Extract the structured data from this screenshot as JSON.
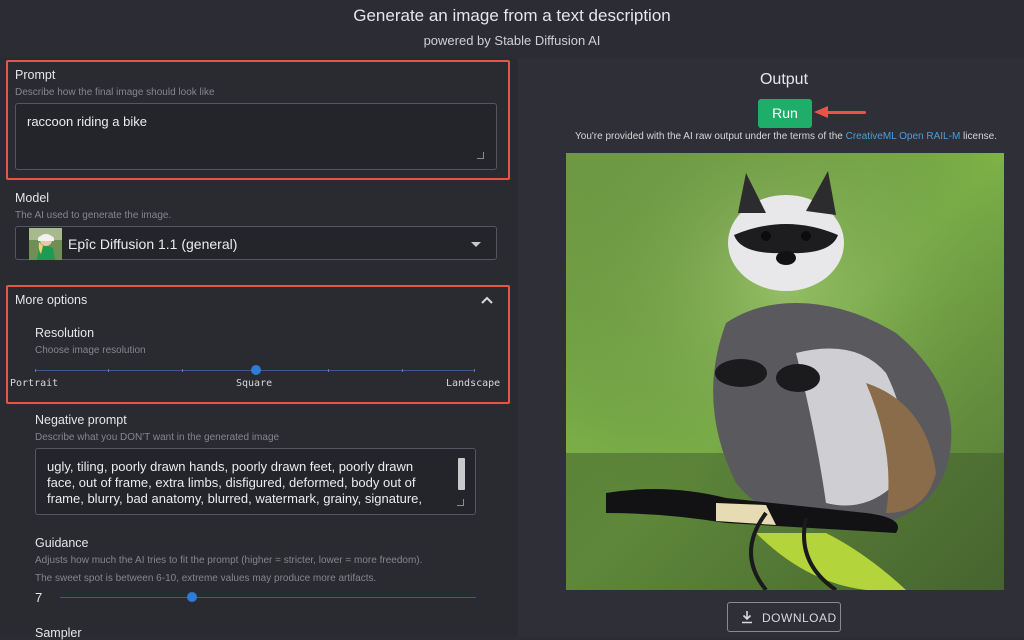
{
  "header": {
    "title": "Generate an image from a text description",
    "subtitle": "powered by Stable Diffusion AI"
  },
  "prompt": {
    "label": "Prompt",
    "help": "Describe how the final image should look like",
    "value": "raccoon riding a bike"
  },
  "model": {
    "label": "Model",
    "help": "The AI used to generate the image.",
    "selected": "Epîc Diffusion 1.1 (general)"
  },
  "more_options": {
    "label": "More options",
    "resolution": {
      "label": "Resolution",
      "help": "Choose image resolution",
      "ticks": [
        "Portrait",
        "Square",
        "Landscape"
      ],
      "value": "Square"
    }
  },
  "negative_prompt": {
    "label": "Negative prompt",
    "help": "Describe what you DON'T want in the generated image",
    "lines": [
      "ugly, tiling, poorly drawn hands, poorly drawn feet, poorly drawn",
      "face, out of frame, extra limbs, disfigured, deformed, body out of",
      "frame, blurry, bad anatomy, blurred, watermark, grainy, signature,"
    ]
  },
  "guidance": {
    "label": "Guidance",
    "help_line1": "Adjusts how much the AI tries to fit the prompt (higher = stricter, lower = more freedom).",
    "help_line2": "The sweet spot is between 6-10, extreme values may produce more artifacts.",
    "value": "7"
  },
  "sampler": {
    "label": "Sampler"
  },
  "output": {
    "heading": "Output",
    "run_label": "Run",
    "license_prefix": "You're provided with the AI raw output under the terms of the ",
    "license_link": "CreativeML Open RAIL-M",
    "license_suffix": " license.",
    "download_label": "DOWNLOAD"
  },
  "colors": {
    "accent_red": "#e8544a",
    "run_green": "#1fae6a",
    "slider_blue": "#2f7bd6"
  },
  "icons": [
    "chevron-up-icon",
    "chevron-down-icon",
    "download-icon",
    "arrow-left-icon"
  ]
}
